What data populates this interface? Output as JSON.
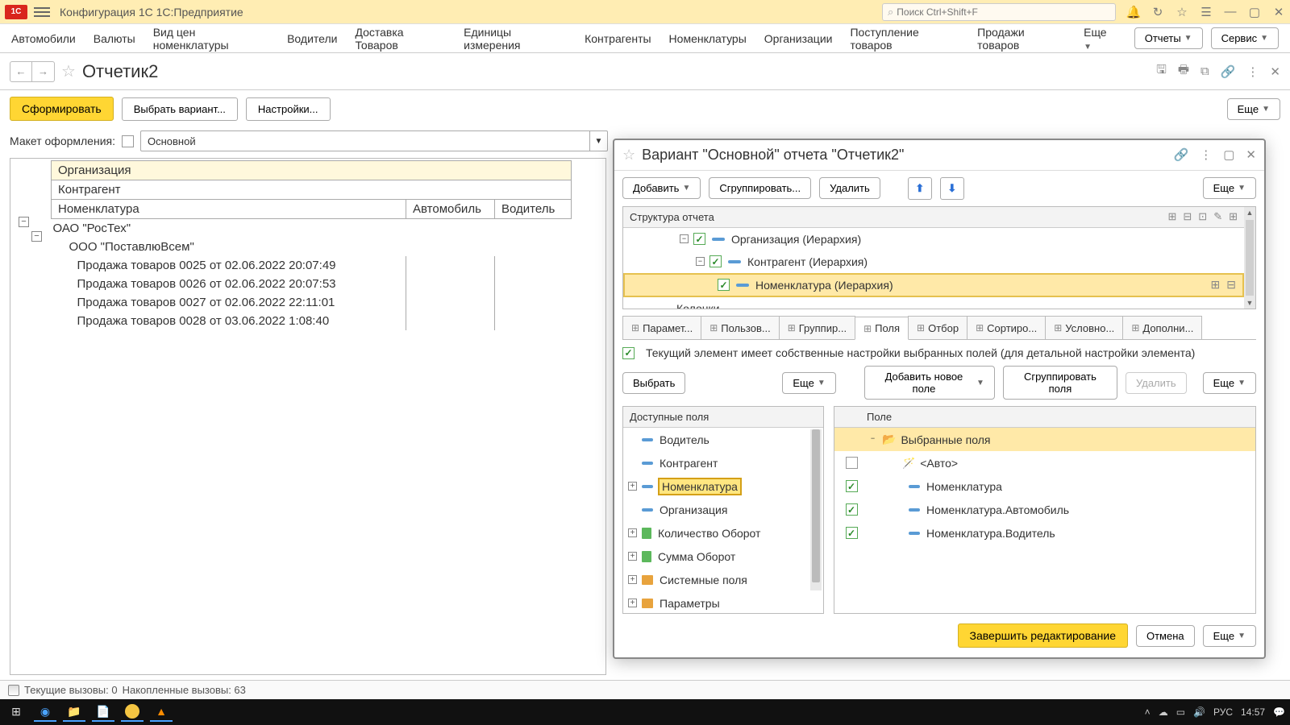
{
  "titlebar": {
    "title": "Конфигурация 1С 1С:Предприятие",
    "search_placeholder": "Поиск Ctrl+Shift+F"
  },
  "mainmenu": {
    "items": [
      "Автомобили",
      "Валюты",
      "Вид цен номенклатуры",
      "Водители",
      "Доставка Товаров",
      "Единицы измерения",
      "Контрагенты",
      "Номенклатуры",
      "Организации",
      "Поступление товаров",
      "Продажи товаров",
      "Еще"
    ],
    "reports": "Отчеты",
    "service": "Сервис"
  },
  "tab": {
    "title": "Отчетик2"
  },
  "toolbar": {
    "form": "Сформировать",
    "choose": "Выбрать вариант...",
    "settings": "Настройки...",
    "more": "Еще"
  },
  "layout": {
    "label": "Макет оформления:",
    "value": "Основной"
  },
  "report": {
    "headers": {
      "org": "Организация",
      "counter": "Контрагент",
      "nomen": "Номенклатура",
      "auto": "Автомобиль",
      "driver": "Водитель"
    },
    "org": "ОАО \"РосТех\"",
    "counter": "ООО \"ПоставлюВсем\"",
    "rows": [
      "Продажа товаров 0025 от 02.06.2022 20:07:49",
      "Продажа товаров 0026 от 02.06.2022 20:07:53",
      "Продажа товаров 0027 от 02.06.2022 22:11:01",
      "Продажа товаров 0028 от 03.06.2022 1:08:40"
    ]
  },
  "dialog": {
    "title": "Вариант \"Основной\" отчета \"Отчетик2\"",
    "add": "Добавить",
    "group": "Сгруппировать...",
    "delete": "Удалить",
    "more": "Еще",
    "struct_header": "Структура отчета",
    "struct": {
      "org": "Организация (Иерархия)",
      "counter": "Контрагент (Иерархия)",
      "nomen": "Номенклатура (Иерархия)",
      "columns": "Колонки"
    },
    "tabs": [
      "Парамет...",
      "Пользов...",
      "Группир...",
      "Поля",
      "Отбор",
      "Сортиро...",
      "Условно...",
      "Дополни..."
    ],
    "own_settings": "Текущий элемент имеет собственные настройки выбранных полей (для детальной настройки элемента)",
    "choose": "Выбрать",
    "add_field": "Добавить новое поле",
    "group_fields": "Сгруппировать поля",
    "delete_field": "Удалить",
    "avail_header": "Доступные поля",
    "sel_header": "Поле",
    "avail": [
      {
        "label": "Водитель",
        "type": "dash",
        "exp": false
      },
      {
        "label": "Контрагент",
        "type": "dash",
        "exp": false
      },
      {
        "label": "Номенклатура",
        "type": "dash",
        "exp": true,
        "hilite": true
      },
      {
        "label": "Организация",
        "type": "dash",
        "exp": false
      },
      {
        "label": "Количество Оборот",
        "type": "bar",
        "exp": true
      },
      {
        "label": "Сумма Оборот",
        "type": "bar",
        "exp": true
      },
      {
        "label": "Системные поля",
        "type": "folder",
        "exp": true
      },
      {
        "label": "Параметры",
        "type": "folder",
        "exp": true
      }
    ],
    "sel_root": "Выбранные поля",
    "sel": [
      {
        "label": "<Авто>",
        "checked": false,
        "icon": "magic"
      },
      {
        "label": "Номенклатура",
        "checked": true,
        "icon": "dash"
      },
      {
        "label": "Номенклатура.Автомобиль",
        "checked": true,
        "icon": "dash"
      },
      {
        "label": "Номенклатура.Водитель",
        "checked": true,
        "icon": "dash"
      }
    ],
    "finish": "Завершить редактирование",
    "cancel": "Отмена"
  },
  "status": {
    "current": "Текущие вызовы: 0",
    "accum": "Накопленные вызовы: 63"
  },
  "tray": {
    "lang": "РУС",
    "time": "14:57"
  }
}
